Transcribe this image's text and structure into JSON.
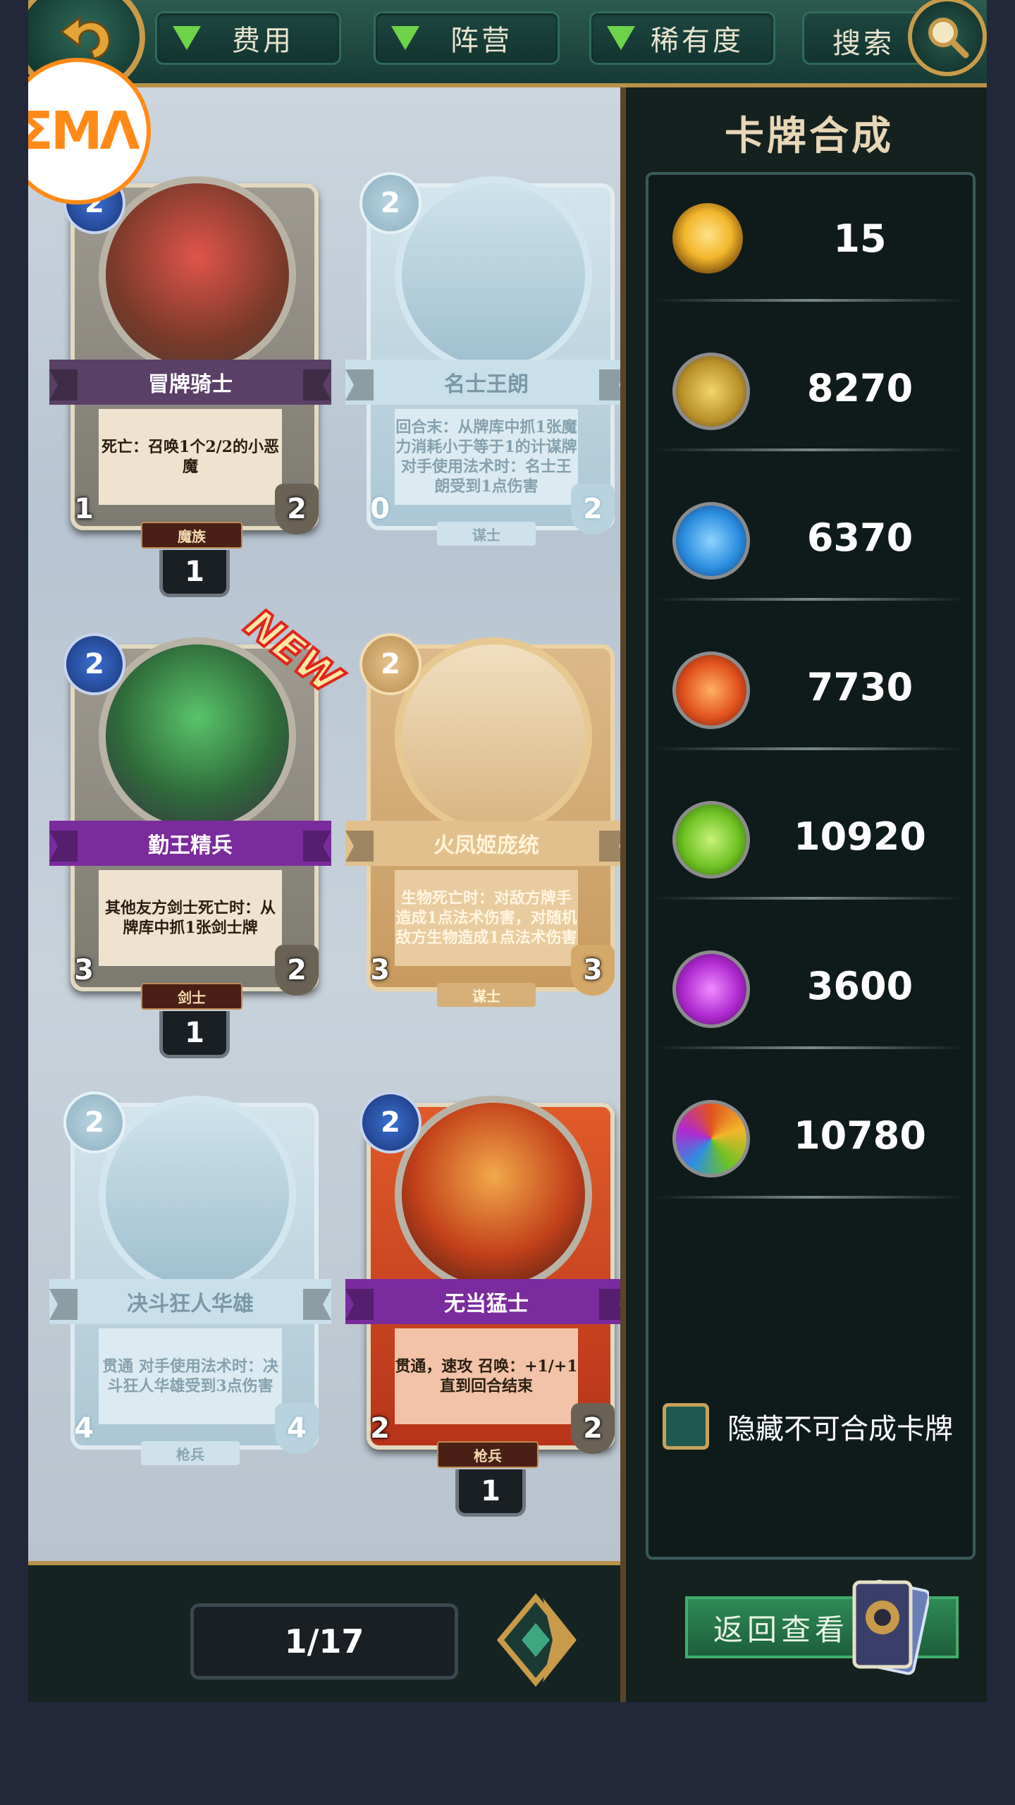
{
  "topbar": {
    "filters": [
      {
        "label": "费用"
      },
      {
        "label": "阵营"
      },
      {
        "label": "稀有度"
      }
    ],
    "search_label": "搜索"
  },
  "logo": {
    "text": "ΣMΛ"
  },
  "cards": [
    {
      "name": "冒牌骑士",
      "cost": "2",
      "desc": "死亡：召唤1个2/2的小恶魔",
      "attack": "1",
      "health": "2",
      "faction": "魔族",
      "count": "1",
      "state": "owned",
      "ribbon_color": "#5a3f66"
    },
    {
      "name": "名士王朗",
      "cost": "2",
      "desc": "回合末：从牌库中抓1张魔力消耗小于等于1的计谋牌 对手使用法术时：名士王朗受到1点伤害",
      "attack": "0",
      "health": "2",
      "faction": "谋士",
      "count": "",
      "state": "ghost"
    },
    {
      "name": "勤王精兵",
      "cost": "2",
      "desc": "其他友方剑士死亡时：从牌库中抓1张剑士牌",
      "attack": "3",
      "health": "2",
      "faction": "剑士",
      "count": "1",
      "state": "owned",
      "is_new": true,
      "new_label": "NEW",
      "ribbon_color": "#7a2b9e"
    },
    {
      "name": "火凤姬庞统",
      "cost": "2",
      "desc": "生物死亡时：对敌方牌手造成1点法术伤害，对随机敌方生物造成1点法术伤害",
      "attack": "3",
      "health": "3",
      "faction": "谋士",
      "count": "",
      "state": "gold"
    },
    {
      "name": "决斗狂人华雄",
      "cost": "2",
      "desc": "贯通 对手使用法术时：决斗狂人华雄受到3点伤害",
      "attack": "4",
      "health": "4",
      "faction": "枪兵",
      "count": "",
      "state": "ghost"
    },
    {
      "name": "无当猛士",
      "cost": "2",
      "desc": "贯通，速攻 召唤：+1/+1直到回合结束",
      "attack": "2",
      "health": "2",
      "faction": "枪兵",
      "count": "1",
      "state": "owned",
      "ribbon_color": "#7a2b9e"
    }
  ],
  "synthesis": {
    "title": "卡牌合成",
    "resources": [
      {
        "icon": "gold-crystal-icon",
        "value": "15",
        "color": "#f2b62b"
      },
      {
        "icon": "compass-emblem-icon",
        "value": "8270",
        "color": "#d8b24a"
      },
      {
        "icon": "water-swirl-icon",
        "value": "6370",
        "color": "#2d8fe0"
      },
      {
        "icon": "fire-swirl-icon",
        "value": "7730",
        "color": "#e2531f"
      },
      {
        "icon": "leaf-swirl-icon",
        "value": "10920",
        "color": "#6fc224"
      },
      {
        "icon": "purple-orb-icon",
        "value": "3600",
        "color": "#b02ad1"
      },
      {
        "icon": "rainbow-swirl-icon",
        "value": "10780",
        "color": "#e0803a"
      }
    ],
    "hide_label": "隐藏不可合成卡牌",
    "return_label": "返回查看"
  },
  "pager": {
    "label": "1/17"
  }
}
